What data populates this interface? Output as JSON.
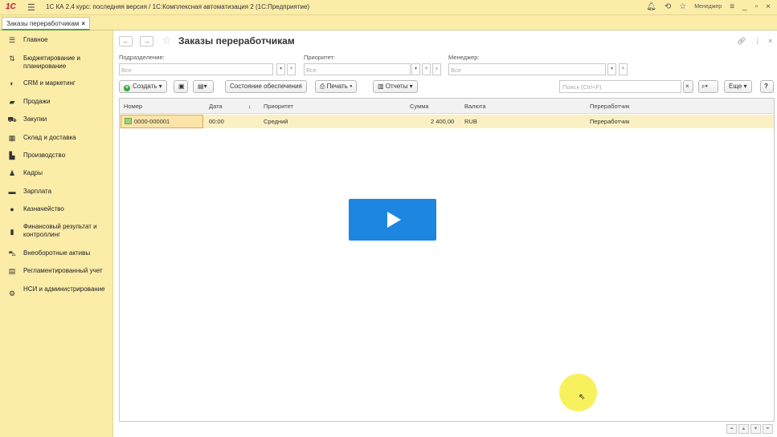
{
  "titlebar": {
    "logo": "1C",
    "menu_icon": "hamburger-icon",
    "title": "1С КА 2.4 курс: последняя версия / 1С:Комплексная автоматизация 2  (1С:Предприятие)",
    "user": "Менеджер"
  },
  "tabs": {
    "open_tab": "Заказы переработчикам",
    "close": "×"
  },
  "sidebar": {
    "items": [
      {
        "label": "Главное",
        "icon": "list-icon"
      },
      {
        "label": "Бюджетирование и планирование",
        "icon": "budget-icon"
      },
      {
        "label": "CRM и маркетинг",
        "icon": "crm-icon"
      },
      {
        "label": "Продажи",
        "icon": "sales-icon"
      },
      {
        "label": "Закупки",
        "icon": "cart-icon"
      },
      {
        "label": "Склад и доставка",
        "icon": "warehouse-icon"
      },
      {
        "label": "Производство",
        "icon": "factory-icon"
      },
      {
        "label": "Кадры",
        "icon": "person-icon"
      },
      {
        "label": "Зарплата",
        "icon": "money-icon"
      },
      {
        "label": "Казначейство",
        "icon": "treasury-icon"
      },
      {
        "label": "Финансовый результат и контроллинг",
        "icon": "chart-icon"
      },
      {
        "label": "Внеоборотные активы",
        "icon": "car-icon"
      },
      {
        "label": "Регламентированный учет",
        "icon": "ledger-icon"
      },
      {
        "label": "НСИ и администрирование",
        "icon": "gear-icon"
      }
    ]
  },
  "page": {
    "title": "Заказы переработчикам",
    "filters": {
      "division_label": "Подразделение:",
      "division_value": "Все",
      "priority_label": "Приоритет:",
      "priority_value": "Все",
      "manager_label": "Менеджер:",
      "manager_value": "Все"
    },
    "toolbar": {
      "create": "Создать",
      "supply_state": "Состояние обеспечения",
      "print": "Печать",
      "reports": "Отчеты",
      "search_placeholder": "Поиск (Ctrl+F)",
      "more": "Еще",
      "help": "?"
    },
    "table": {
      "columns": [
        "Номер",
        "Дата",
        "Приоритет",
        "Сумма",
        "Валюта",
        "Переработчик"
      ],
      "rows": [
        {
          "number": "0000-000001",
          "date": "00:00",
          "priority": "Средний",
          "sum": "2 400,00",
          "currency": "RUB",
          "processor": "Переработчик"
        }
      ]
    }
  }
}
